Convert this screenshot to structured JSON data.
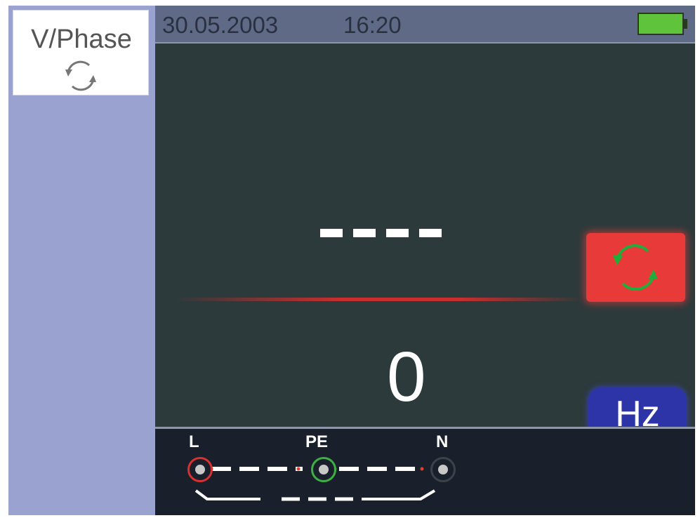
{
  "sidebar": {
    "mode_label": "V/Phase",
    "mode_icon": "phase-rotation-icon"
  },
  "status_bar": {
    "date": "30.05.2003",
    "time": "16:20",
    "battery_icon": "battery-full-icon",
    "battery_color": "#5fc43b"
  },
  "main": {
    "primary_reading": "----",
    "primary_button_icon": "phase-rotation-icon",
    "primary_button_color": "#e93a3a",
    "secondary_reading": "0",
    "secondary_unit": "Hz",
    "secondary_button_color": "#2c34a8"
  },
  "connection": {
    "terminals": [
      {
        "label": "L",
        "color": "#d93030"
      },
      {
        "label": "PE",
        "color": "#3cb043"
      },
      {
        "label": "N",
        "color": "#2a3338"
      }
    ]
  }
}
